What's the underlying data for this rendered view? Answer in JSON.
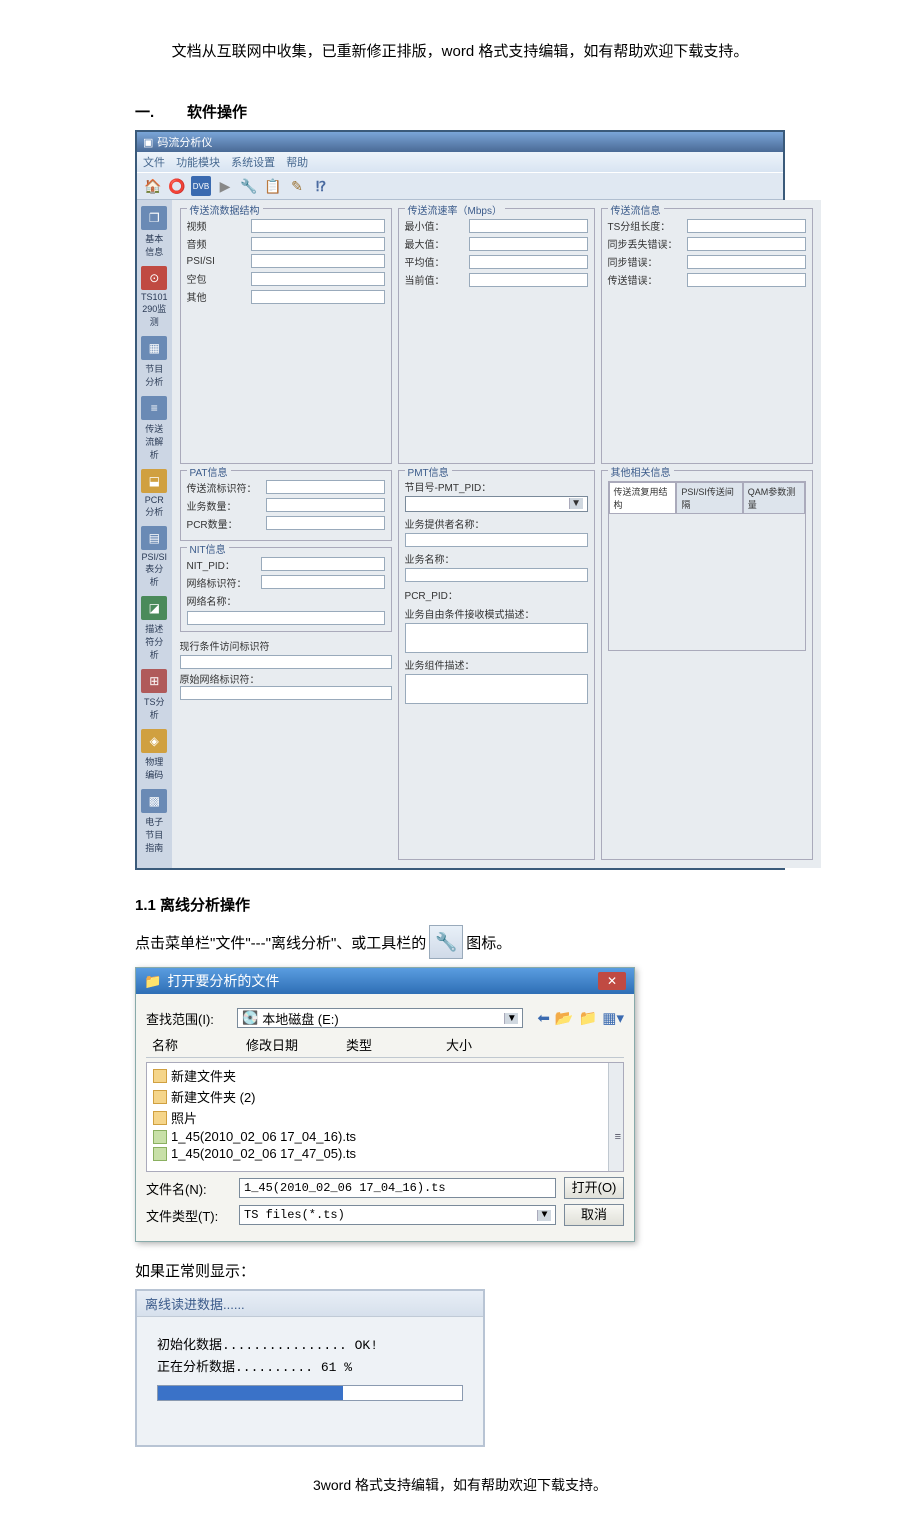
{
  "header_note": "文档从互联网中收集，已重新修正排版，word 格式支持编辑，如有帮助欢迎下载支持。",
  "section1": {
    "num": "一.",
    "title": "软件操作"
  },
  "app": {
    "title": "码流分析仪",
    "menu": [
      "文件",
      "功能模块",
      "系统设置",
      "帮助"
    ],
    "toolbar_icons": [
      "home-icon",
      "record-icon",
      "dvb-icon",
      "play-icon",
      "analyze-icon",
      "list-icon",
      "edit-icon",
      "help-icon"
    ],
    "sidebar": [
      {
        "label": "基本信息"
      },
      {
        "label": "TS101 290监测"
      },
      {
        "label": "节目分析"
      },
      {
        "label": "传送流解析"
      },
      {
        "label": "PCR分析"
      },
      {
        "label": "PSI/SI表分析"
      },
      {
        "label": "描述符分析"
      },
      {
        "label": "TS分析"
      },
      {
        "label": "物理编码"
      },
      {
        "label": "电子节目指南"
      }
    ],
    "groups": {
      "struct": {
        "title": "传送流数据结构",
        "fields": [
          "视频",
          "音频",
          "PSI/SI",
          "空包",
          "其他"
        ]
      },
      "rate": {
        "title": "传送流速率（Mbps）",
        "fields": [
          "最小值：",
          "最大值：",
          "平均值：",
          "当前值："
        ]
      },
      "info": {
        "title": "传送流信息",
        "fields": [
          "TS分组长度：",
          "同步丢失错误：",
          "同步错误：",
          "传送错误："
        ]
      },
      "pat": {
        "title": "PAT信息",
        "fields": [
          "传送流标识符：",
          "业务数量：",
          "PCR数量："
        ]
      },
      "nit": {
        "title": "NIT信息",
        "fields": [
          "NIT_PID：",
          "网络标识符：",
          "网络名称："
        ]
      },
      "cond": {
        "title": "",
        "fields": [
          "现行条件访问标识符",
          "原始网络标识符："
        ]
      },
      "pmt": {
        "title": "PMT信息",
        "fields": [
          "节目号-PMT_PID：",
          "业务提供者名称：",
          "业务名称：",
          "PCR_PID：",
          "业务自由条件接收模式描述：",
          "业务组件描述："
        ]
      },
      "other": {
        "title": "其他相关信息",
        "tabs": [
          "传送流复用结构",
          "PSI/SI传送间隔",
          "QAM参数测量"
        ]
      }
    }
  },
  "sub11": {
    "num": "1.1",
    "title": "离线分析操作"
  },
  "text_click": "点击菜单栏\"文件\"---\"离线分析\"、或工具栏的",
  "text_click_end": "图标。",
  "dialog": {
    "title": "打开要分析的文件",
    "range_lbl": "查找范围(I):",
    "range_val": "本地磁盘 (E:)",
    "cols": [
      "名称",
      "修改日期",
      "类型",
      "大小"
    ],
    "files": [
      {
        "name": "新建文件夹",
        "type": "folder"
      },
      {
        "name": "新建文件夹 (2)",
        "type": "folder"
      },
      {
        "name": "照片",
        "type": "folder"
      },
      {
        "name": "1_45(2010_02_06 17_04_16).ts",
        "type": "ts"
      },
      {
        "name": "1_45(2010_02_06 17_47_05).ts",
        "type": "ts"
      }
    ],
    "fn_lbl": "文件名(N):",
    "fn_val": "1_45(2010_02_06 17_04_16).ts",
    "ft_lbl": "文件类型(T):",
    "ft_val": "TS files(*.ts)",
    "open_btn": "打开(O)",
    "cancel_btn": "取消"
  },
  "normal_text": "如果正常则显示：",
  "progress": {
    "title": "离线读进数据......",
    "line1": "初始化数据................ OK!",
    "line2": "正在分析数据.......... 61 %",
    "percent": 61
  },
  "footer": "3word 格式支持编辑，如有帮助欢迎下载支持。"
}
